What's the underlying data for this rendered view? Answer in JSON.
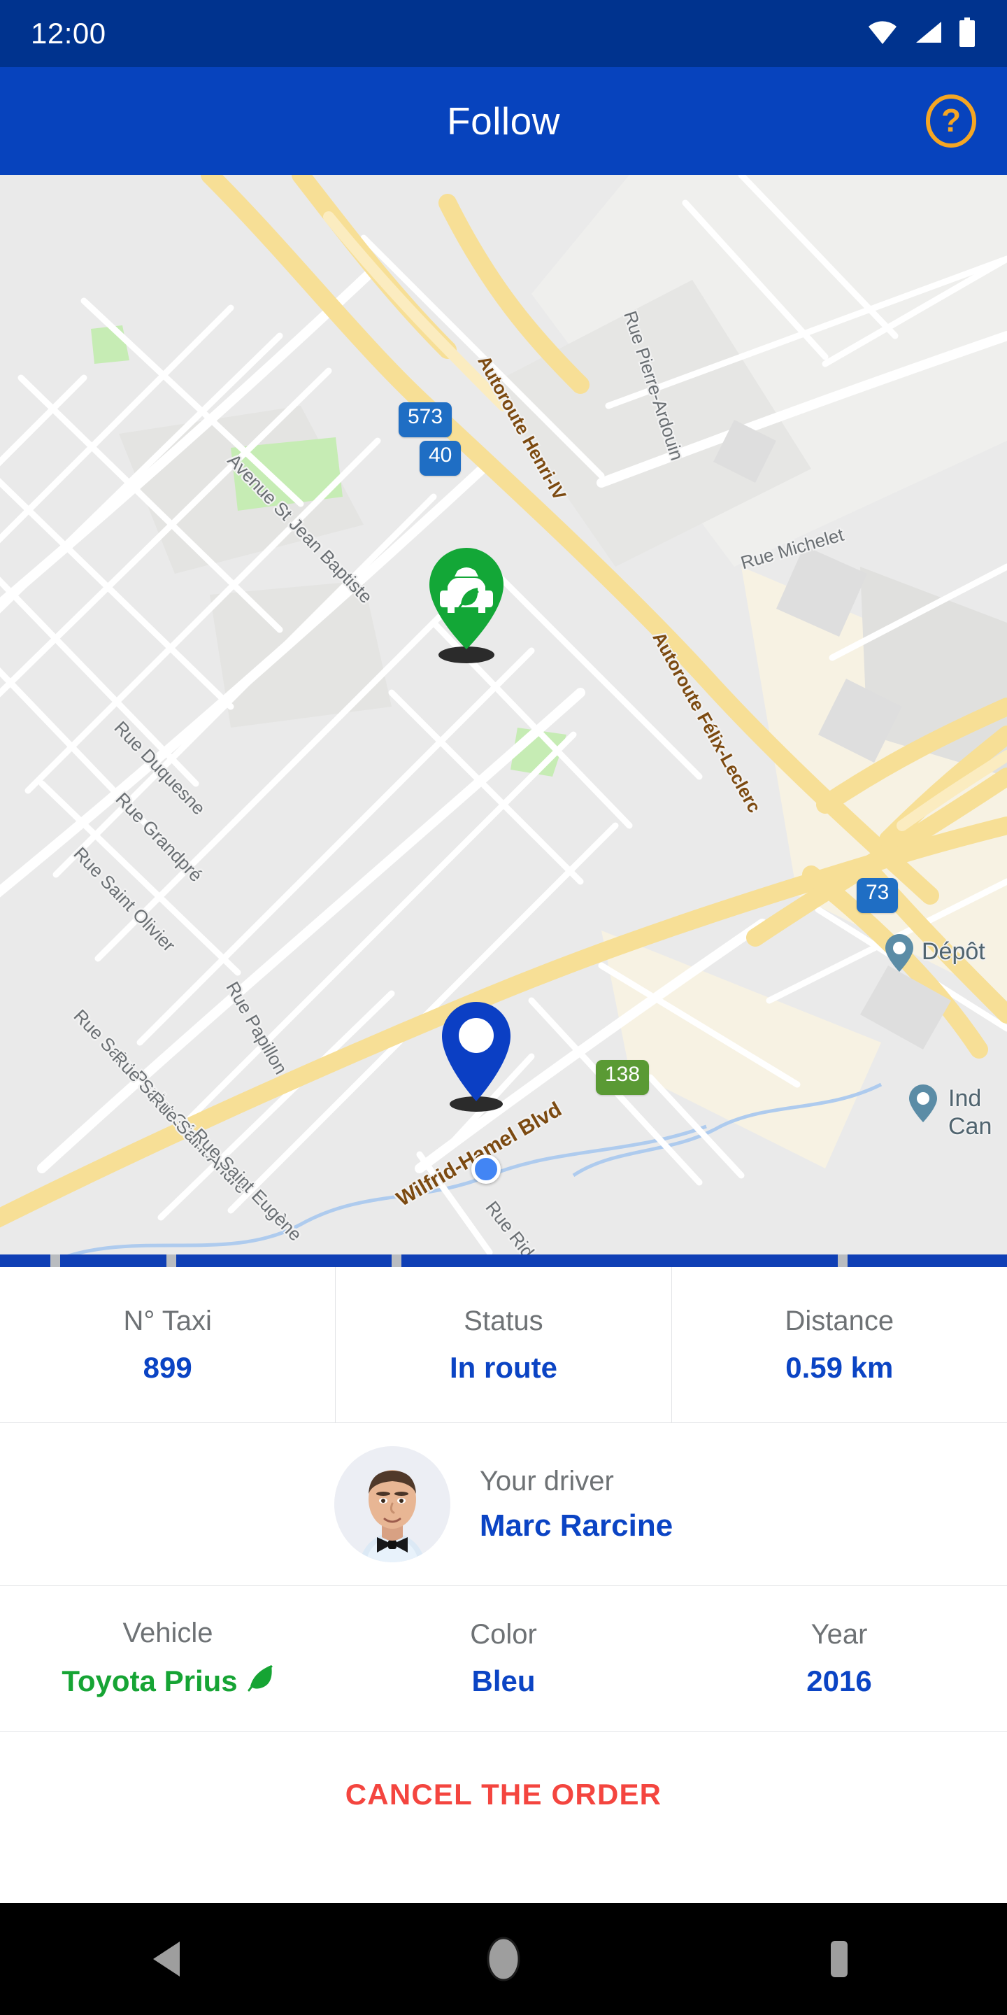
{
  "status_bar": {
    "time": "12:00",
    "icons": [
      "wifi-icon",
      "cellular-signal-icon",
      "battery-icon"
    ]
  },
  "app_bar": {
    "title": "Follow",
    "help_icon": "help-circle-icon",
    "background_color": "#0743bd",
    "help_color": "#f5a623"
  },
  "map": {
    "taxi_marker": {
      "icon": "taxi-eco-pin",
      "color": "#13a737"
    },
    "destination_marker": {
      "icon": "location-pin",
      "color": "#0b3fc4"
    },
    "user_location_dot": {
      "icon": "user-location-dot",
      "color": "#4285f4"
    },
    "street_labels": [
      "Avenue St Jean Baptiste",
      "Rue Duquesne",
      "Rue Grandpré",
      "Rue Saint Olivier",
      "Rue Saint Paul",
      "Rue Saint Gérard",
      "Rue Saint André",
      "Rue Saint Eugène",
      "Rue Papillon",
      "Rue Pierre-Ardouin",
      "Rue Michelet",
      "Rue Rid",
      "Autoroute Henri-IV",
      "Autoroute Félix-Leclerc",
      "Wilfrid-Hamel Blvd"
    ],
    "highway_shields": [
      {
        "label": "573",
        "style": "blue"
      },
      {
        "label": "40",
        "style": "blue"
      },
      {
        "label": "73",
        "style": "blue"
      },
      {
        "label": "138",
        "style": "green"
      }
    ],
    "poi_labels": [
      {
        "name": "Dépôt",
        "lines": [
          "Dépôt"
        ]
      },
      {
        "name": "Ind Can",
        "lines": [
          "Ind",
          "Can"
        ]
      }
    ]
  },
  "progress": {
    "segments": 5,
    "filled_color": "#0f3fb5",
    "gap_color": "#b9bcc0"
  },
  "trip_info": [
    {
      "label": "N° Taxi",
      "value": "899"
    },
    {
      "label": "Status",
      "value": "In route"
    },
    {
      "label": "Distance",
      "value": "0.59 km"
    }
  ],
  "driver": {
    "label": "Your driver",
    "name": "Marc Rarcine",
    "avatar": "driver-avatar"
  },
  "vehicle": [
    {
      "label": "Vehicle",
      "value": "Toyota Prius",
      "eco": true
    },
    {
      "label": "Color",
      "value": "Bleu",
      "eco": false
    },
    {
      "label": "Year",
      "value": "2016",
      "eco": false
    }
  ],
  "actions": {
    "cancel_label": "CANCEL THE ORDER",
    "cancel_color": "#f4453f"
  },
  "nav_bar": {
    "back": "back-triangle-icon",
    "home": "home-circle-icon",
    "recents": "recents-square-icon"
  }
}
